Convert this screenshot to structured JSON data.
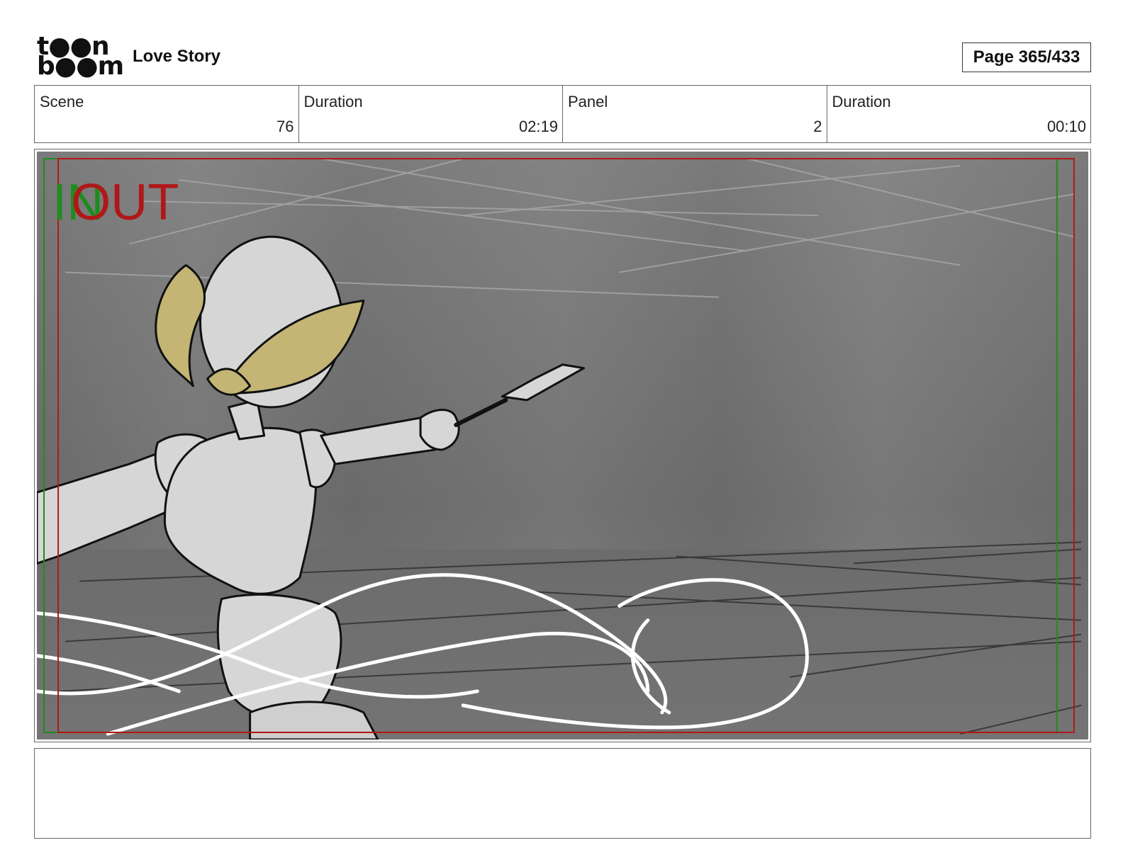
{
  "header": {
    "logo_line1": "t●●n",
    "logo_line2": "b●●m",
    "project_title": "Love Story",
    "page_label": "Page 365/433"
  },
  "info": [
    {
      "label": "Scene",
      "value": "76"
    },
    {
      "label": "Duration",
      "value": "02:19"
    },
    {
      "label": "Panel",
      "value": "2"
    },
    {
      "label": "Duration",
      "value": "00:10"
    }
  ],
  "panel": {
    "in_marker": "IN",
    "out_marker": "OUT",
    "colors": {
      "background": "#6e6e6e",
      "hair": "#c4b575",
      "body": "#d6d6d6",
      "in_guide": "#1e8c1e",
      "out_guide": "#b01818"
    }
  },
  "notes": {
    "text": ""
  }
}
